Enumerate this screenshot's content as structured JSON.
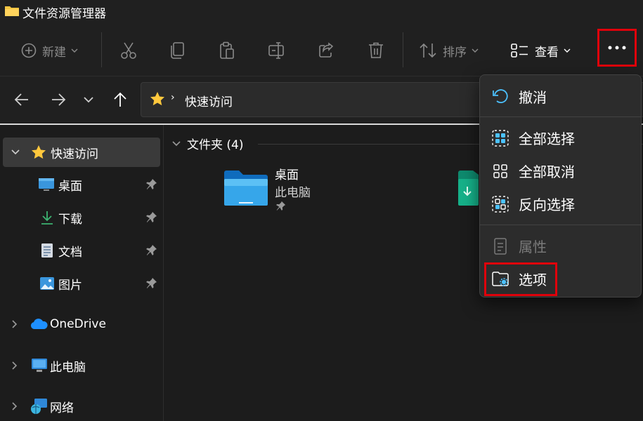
{
  "window": {
    "title": "文件资源管理器",
    "icon": "folder-icon"
  },
  "toolbar": {
    "new_label": "新建",
    "sort_label": "排序",
    "view_label": "查看",
    "more_icon": "more-dots-icon",
    "highlight_color": "#e0000b"
  },
  "address": {
    "location": "快速访问",
    "separator": "›",
    "icon": "star-icon"
  },
  "sidebar": {
    "quick_access": "快速访问",
    "items": [
      {
        "label": "桌面",
        "icon": "desktop-icon",
        "pinned": true
      },
      {
        "label": "下载",
        "icon": "download-icon",
        "pinned": true
      },
      {
        "label": "文档",
        "icon": "document-icon",
        "pinned": true
      },
      {
        "label": "图片",
        "icon": "pictures-icon",
        "pinned": true
      }
    ],
    "onedrive": "OneDrive",
    "this_pc": "此电脑",
    "network": "网络"
  },
  "main": {
    "group_label": "文件夹 (4)",
    "tiles": [
      {
        "name": "桌面",
        "subtitle": "此电脑",
        "pinned": true
      }
    ]
  },
  "menu": {
    "undo": "撤消",
    "select_all": "全部选择",
    "select_none": "全部取消",
    "invert_selection": "反向选择",
    "properties": "属性",
    "options": "选项"
  }
}
